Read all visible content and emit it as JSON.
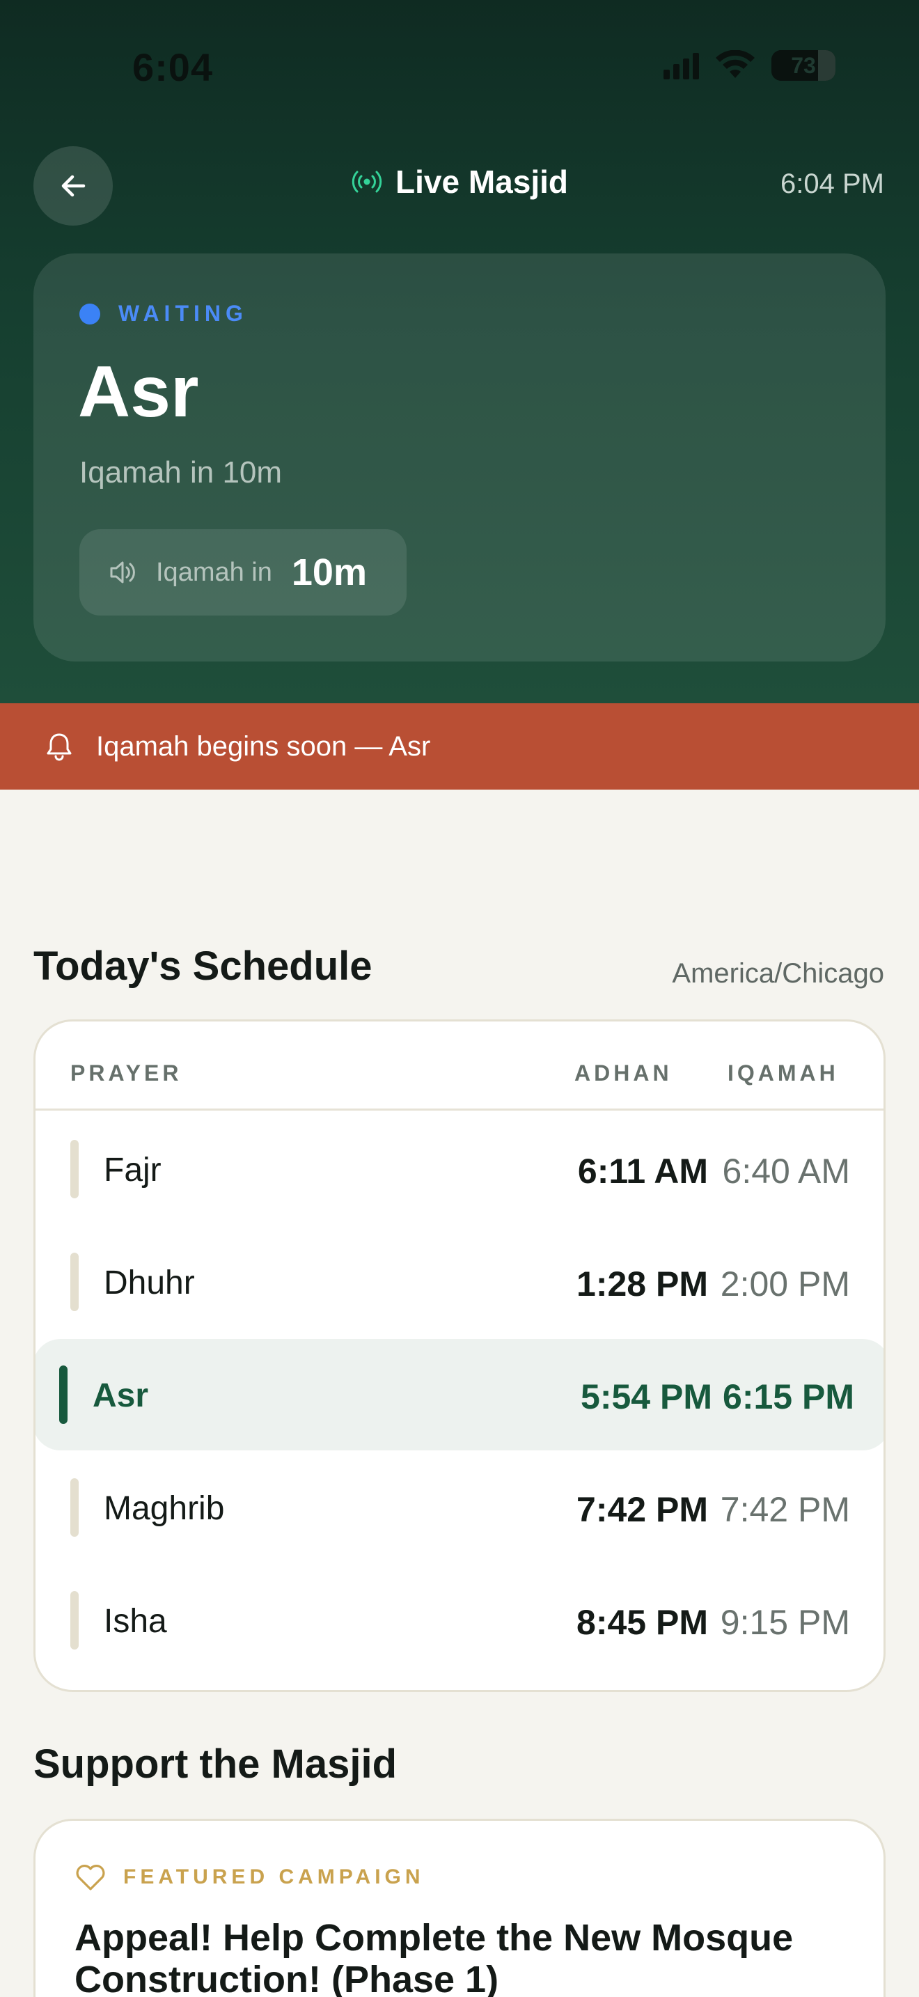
{
  "status_bar": {
    "time": "6:04",
    "battery": "73"
  },
  "nav": {
    "title": "Live Masjid",
    "time": "6:04 PM"
  },
  "current": {
    "state": "WAITING",
    "prayer": "Asr",
    "subtitle": "Iqamah in 10m",
    "chip_label": "Iqamah in",
    "chip_value": "10m"
  },
  "alert": {
    "text": "Iqamah begins soon — Asr"
  },
  "schedule": {
    "title": "Today's Schedule",
    "timezone": "America/Chicago",
    "headers": {
      "prayer": "PRAYER",
      "adhan": "ADHAN",
      "iqamah": "IQAMAH"
    },
    "rows": [
      {
        "name": "Fajr",
        "adhan": "6:11 AM",
        "iqamah": "6:40 AM"
      },
      {
        "name": "Dhuhr",
        "adhan": "1:28 PM",
        "iqamah": "2:00 PM"
      },
      {
        "name": "Asr",
        "adhan": "5:54 PM",
        "iqamah": "6:15 PM"
      },
      {
        "name": "Maghrib",
        "adhan": "7:42 PM",
        "iqamah": "7:42 PM"
      },
      {
        "name": "Isha",
        "adhan": "8:45 PM",
        "iqamah": "9:15 PM"
      }
    ]
  },
  "support": {
    "title": "Support the Masjid",
    "featured_label": "FEATURED CAMPAIGN",
    "campaign_title": "Appeal! Help Complete the New Mosque Construction! (Phase 1)"
  },
  "colors": {
    "hero_dark": "#0F2B22",
    "accent_green": "#17593D",
    "alert": "#B94F34",
    "waiting_blue": "#3B82F6",
    "gold": "#C9A24E"
  }
}
